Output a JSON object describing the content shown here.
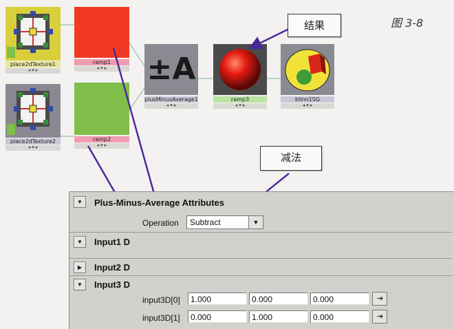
{
  "figure_label": "图 3-8",
  "callouts": {
    "result": "结果",
    "subtract": "减法"
  },
  "nodes": {
    "place2d_1": "place2dTexture1",
    "ramp1": "ramp1",
    "place2d_2": "place2dTexture2",
    "ramp2": "ramp2",
    "pma": "plusMinusAverage1",
    "pma_symbol": "±A",
    "ramp3": "ramp3",
    "shader": "blinn1SG"
  },
  "colors": {
    "ramp1": "#f23a22",
    "ramp2": "#7fbf4a",
    "ramp_label": "#ef9bb0",
    "ramp3_label": "#b9e3a3"
  },
  "attributes": {
    "section_title": "Plus-Minus-Average Attributes",
    "operation_label": "Operation",
    "operation_value": "Subtract",
    "input1": "Input1 D",
    "input2": "Input2 D",
    "input3": "Input3 D",
    "rows": [
      {
        "label": "input3D[0]",
        "values": [
          "1.000",
          "0.000",
          "0.000"
        ]
      },
      {
        "label": "input3D[1]",
        "values": [
          "0.000",
          "1.000",
          "0.000"
        ]
      }
    ]
  }
}
